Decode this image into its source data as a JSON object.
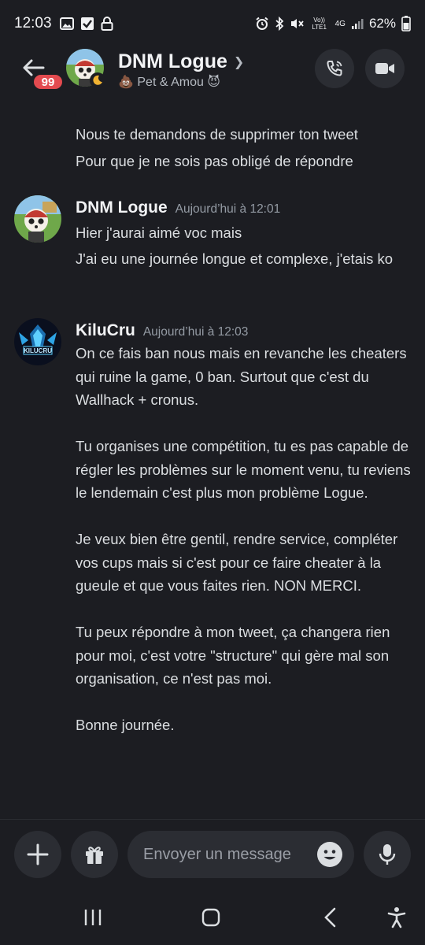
{
  "status_bar": {
    "time": "12:03",
    "battery": "62%",
    "network_top": "4G",
    "volte": "Vo)) LTE1"
  },
  "header": {
    "unread_count": "99",
    "channel_name": "DNM Logue",
    "subtitle": "💩 Pet & Amou 😈"
  },
  "messages": {
    "continued": {
      "lines": [
        "Nous te demandons de supprimer ton tweet",
        "Pour que je ne sois pas obligé de répondre"
      ]
    },
    "group1": {
      "author": "DNM Logue",
      "timestamp": "Aujourd’hui à 12:01",
      "line1": "Hier j'aurai aimé voc mais",
      "line2": "J'ai eu une journée longue et complexe, j'etais ko"
    },
    "group2": {
      "author": "KiluCru",
      "avatar_text": "KILUCRU",
      "timestamp": "Aujourd’hui à 12:03",
      "body": "On ce fais ban nous mais en revanche les cheaters qui ruine la game, 0 ban. Surtout que c'est du Wallhack + cronus.\n\nTu organises une compétition, tu es pas capable de régler les problèmes sur le moment venu, tu reviens le lendemain c'est plus mon problème Logue.\n\nJe veux bien être gentil, rendre service, compléter vos cups mais si c'est pour ce faire cheater à la gueule et que vous faites rien. NON MERCI.\n\nTu peux répondre à mon tweet, ça changera rien pour moi, c'est votre \"structure\" qui gère mal son organisation, ce n'est pas moi.\n\nBonne journée."
    }
  },
  "composer": {
    "placeholder": "Envoyer un message"
  },
  "colors": {
    "background": "#1c1d22",
    "badge": "#e34a4f",
    "control": "#2b2d33"
  }
}
